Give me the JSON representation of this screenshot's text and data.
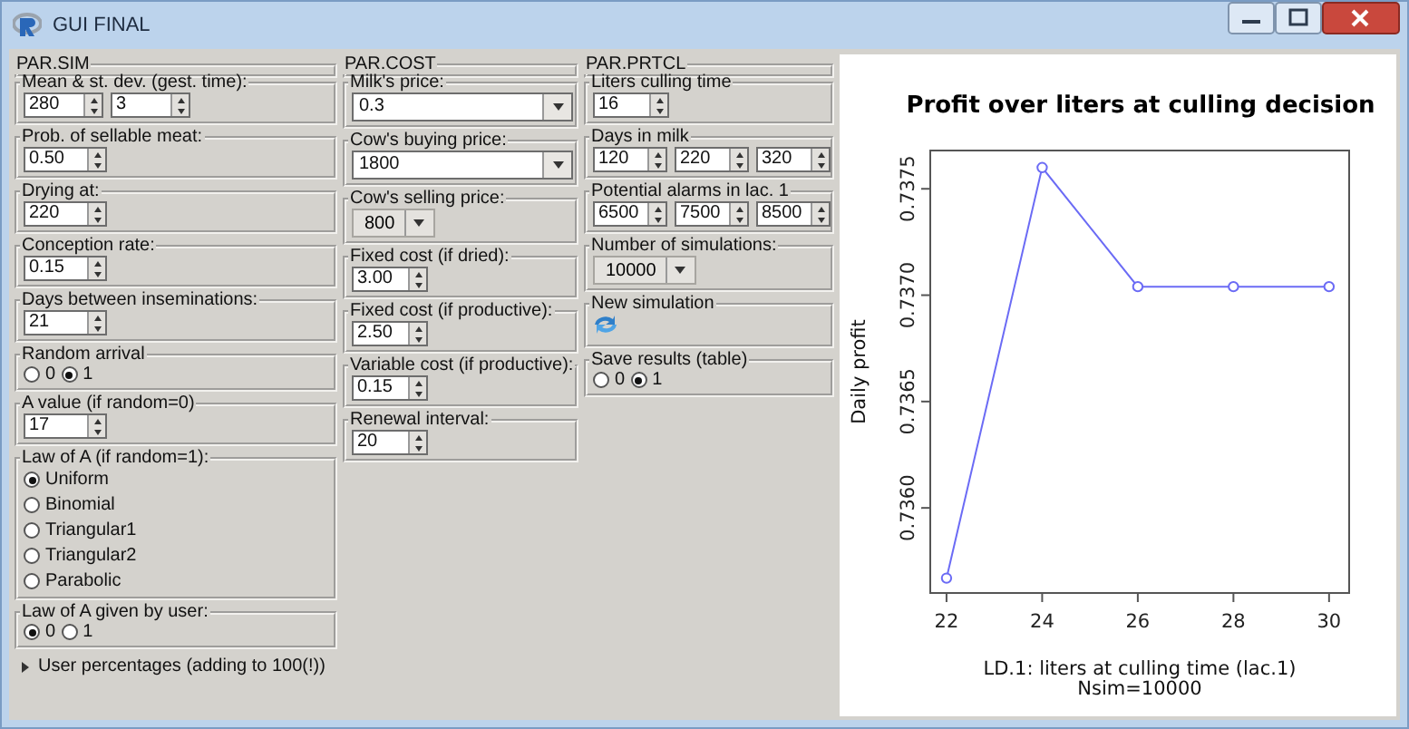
{
  "window": {
    "title": "GUI FINAL"
  },
  "columns": [
    {
      "header": "PAR.SIM",
      "groups": [
        {
          "label": "Mean & st. dev. (gest. time):",
          "kind": "spinbox",
          "values": [
            "280",
            "3"
          ]
        },
        {
          "label": "Prob. of sellable meat:",
          "kind": "spinbox",
          "values": [
            "0.50"
          ]
        },
        {
          "label": "Drying at:",
          "kind": "spinbox",
          "values": [
            "220"
          ]
        },
        {
          "label": "Conception rate:",
          "kind": "spinbox",
          "values": [
            "0.15"
          ]
        },
        {
          "label": "Days between inseminations:",
          "kind": "spinbox",
          "values": [
            "21"
          ]
        },
        {
          "label": "Random arrival",
          "kind": "radio",
          "options": [
            {
              "label": "0",
              "selected": false
            },
            {
              "label": "1",
              "selected": true
            }
          ]
        },
        {
          "label": "A value (if random=0)",
          "kind": "spinbox",
          "values": [
            "17"
          ]
        },
        {
          "label": "Law of A (if random=1):",
          "kind": "radio-list",
          "options": [
            {
              "label": "Uniform",
              "selected": true
            },
            {
              "label": "Binomial",
              "selected": false
            },
            {
              "label": "Triangular1",
              "selected": false
            },
            {
              "label": "Triangular2",
              "selected": false
            },
            {
              "label": "Parabolic",
              "selected": false
            }
          ]
        },
        {
          "label": "Law of A given by user:",
          "kind": "radio",
          "options": [
            {
              "label": "0",
              "selected": true
            },
            {
              "label": "1",
              "selected": false
            }
          ]
        },
        {
          "label": "User percentages (adding to 100(!))",
          "kind": "expander",
          "expanded": false
        }
      ]
    },
    {
      "header": "PAR.COST",
      "groups": [
        {
          "label": "Milk's price:",
          "kind": "combo",
          "value": "0.3"
        },
        {
          "label": "Cow's buying price:",
          "kind": "combo",
          "value": "1800"
        },
        {
          "label": "Cow's selling price:",
          "kind": "menu",
          "value": "800"
        },
        {
          "label": "Fixed cost (if dried):",
          "kind": "spinbox",
          "values": [
            "3.00"
          ]
        },
        {
          "label": "Fixed cost (if productive):",
          "kind": "spinbox",
          "values": [
            "2.50"
          ]
        },
        {
          "label": "Variable cost (if productive):",
          "kind": "spinbox",
          "values": [
            "0.15"
          ]
        },
        {
          "label": "Renewal interval:",
          "kind": "spinbox",
          "values": [
            "20"
          ]
        }
      ]
    },
    {
      "header": "PAR.PRTCL",
      "groups": [
        {
          "label": "Liters culling time",
          "kind": "spinbox",
          "values": [
            "16"
          ]
        },
        {
          "label": "Days in milk",
          "kind": "spinbox",
          "values": [
            "120",
            "220",
            "320"
          ]
        },
        {
          "label": "Potential alarms in lac. 1",
          "kind": "spinbox",
          "values": [
            "6500",
            "7500",
            "8500"
          ]
        },
        {
          "label": "Number of simulations:",
          "kind": "menu",
          "value": "10000"
        },
        {
          "label": "New simulation",
          "kind": "icon-button"
        },
        {
          "label": "Save results (table)",
          "kind": "radio",
          "options": [
            {
              "label": "0",
              "selected": false
            },
            {
              "label": "1",
              "selected": true
            }
          ]
        }
      ]
    }
  ],
  "plot": {
    "subtitle": "Nsim=10000",
    "chart_data": {
      "type": "line",
      "title": "Profit over liters at culling decision",
      "xlabel": "LD.1: liters at culling time (lac.1)",
      "ylabel": "Daily profit",
      "x": [
        22,
        24,
        26,
        28,
        30
      ],
      "series": [
        {
          "color": "#6b6bf5",
          "marker": "circle",
          "values": [
            0.73567,
            0.7376,
            0.73704,
            0.73704,
            0.73704
          ]
        }
      ],
      "xlim": [
        21.66,
        30.42
      ],
      "ylim": [
        0.7356,
        0.73768
      ],
      "xticks": [
        22,
        24,
        26,
        28,
        30
      ],
      "yticks": [
        {
          "value": 0.736,
          "label": "0.7360"
        },
        {
          "value": 0.7365,
          "label": "0.7365"
        },
        {
          "value": 0.737,
          "label": "0.7370"
        },
        {
          "value": 0.7375,
          "label": "0.7375"
        }
      ]
    }
  }
}
